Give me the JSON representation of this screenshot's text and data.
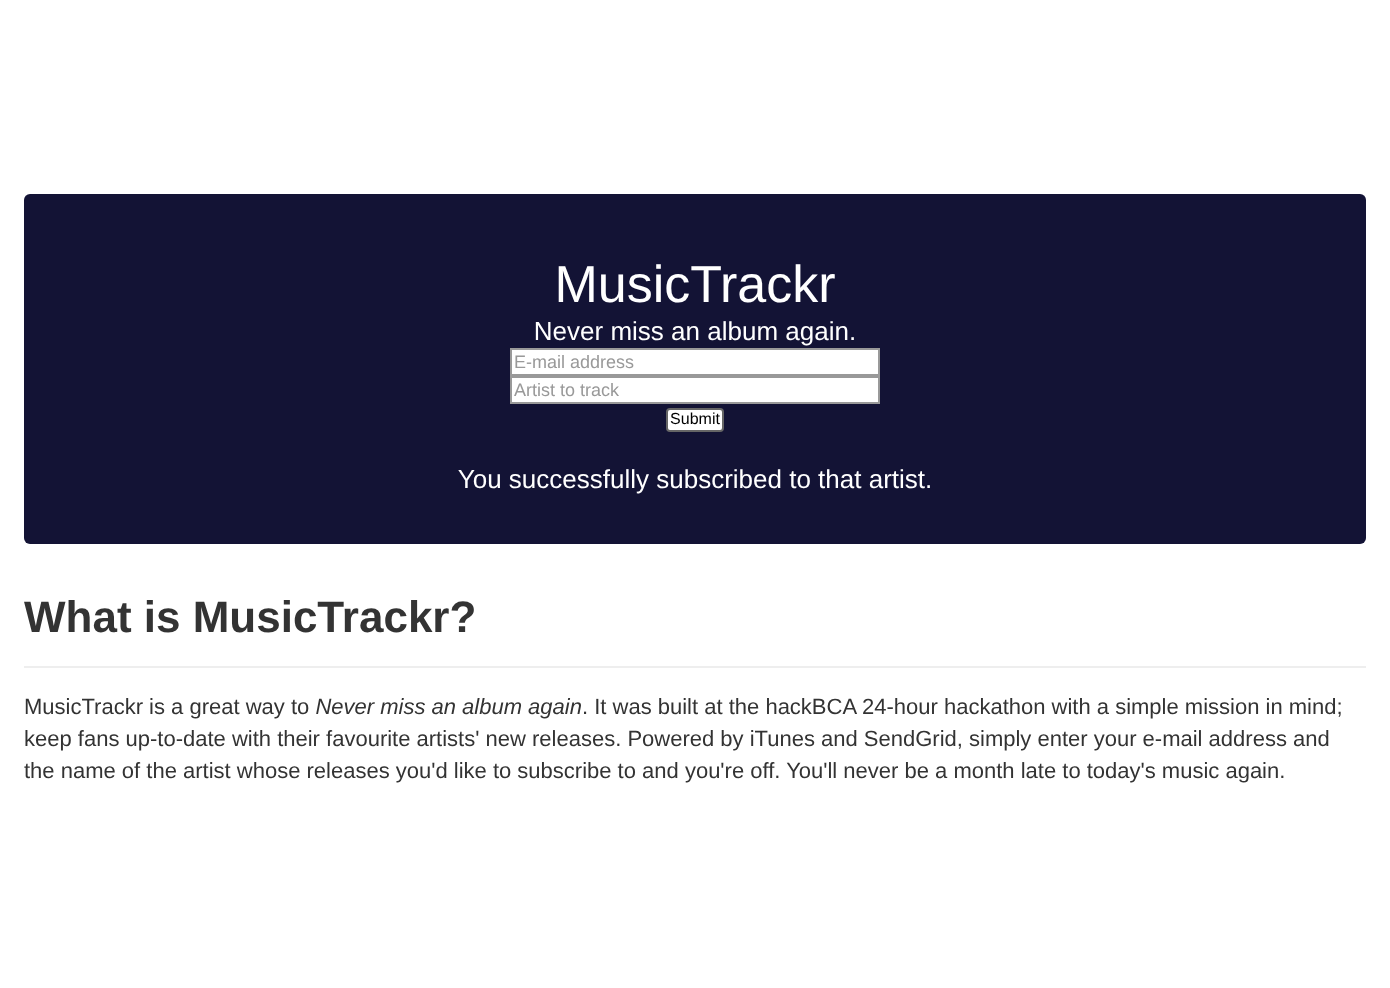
{
  "hero": {
    "title": "MusicTrackr",
    "tagline": "Never miss an album again.",
    "fields": [
      {
        "placeholder": "E-mail address"
      },
      {
        "placeholder": "Artist to track"
      }
    ],
    "submit": "Submit",
    "message": "You successfully subscribed to that artist."
  },
  "about": {
    "heading": "What is MusicTrackr?",
    "paragraph": "MusicTrackr is a great way to *Never miss an album again*. It was built at the hackBCA 24-hour hackathon with a simple mission in mind; keep fans up-to-date with their favourite artists' new releases. Powered by iTunes and SendGrid, simply enter your e-mail address and the name of the artist whose releases you'd like to subscribe to and you're off. You'll never be a month late to today's music again."
  }
}
